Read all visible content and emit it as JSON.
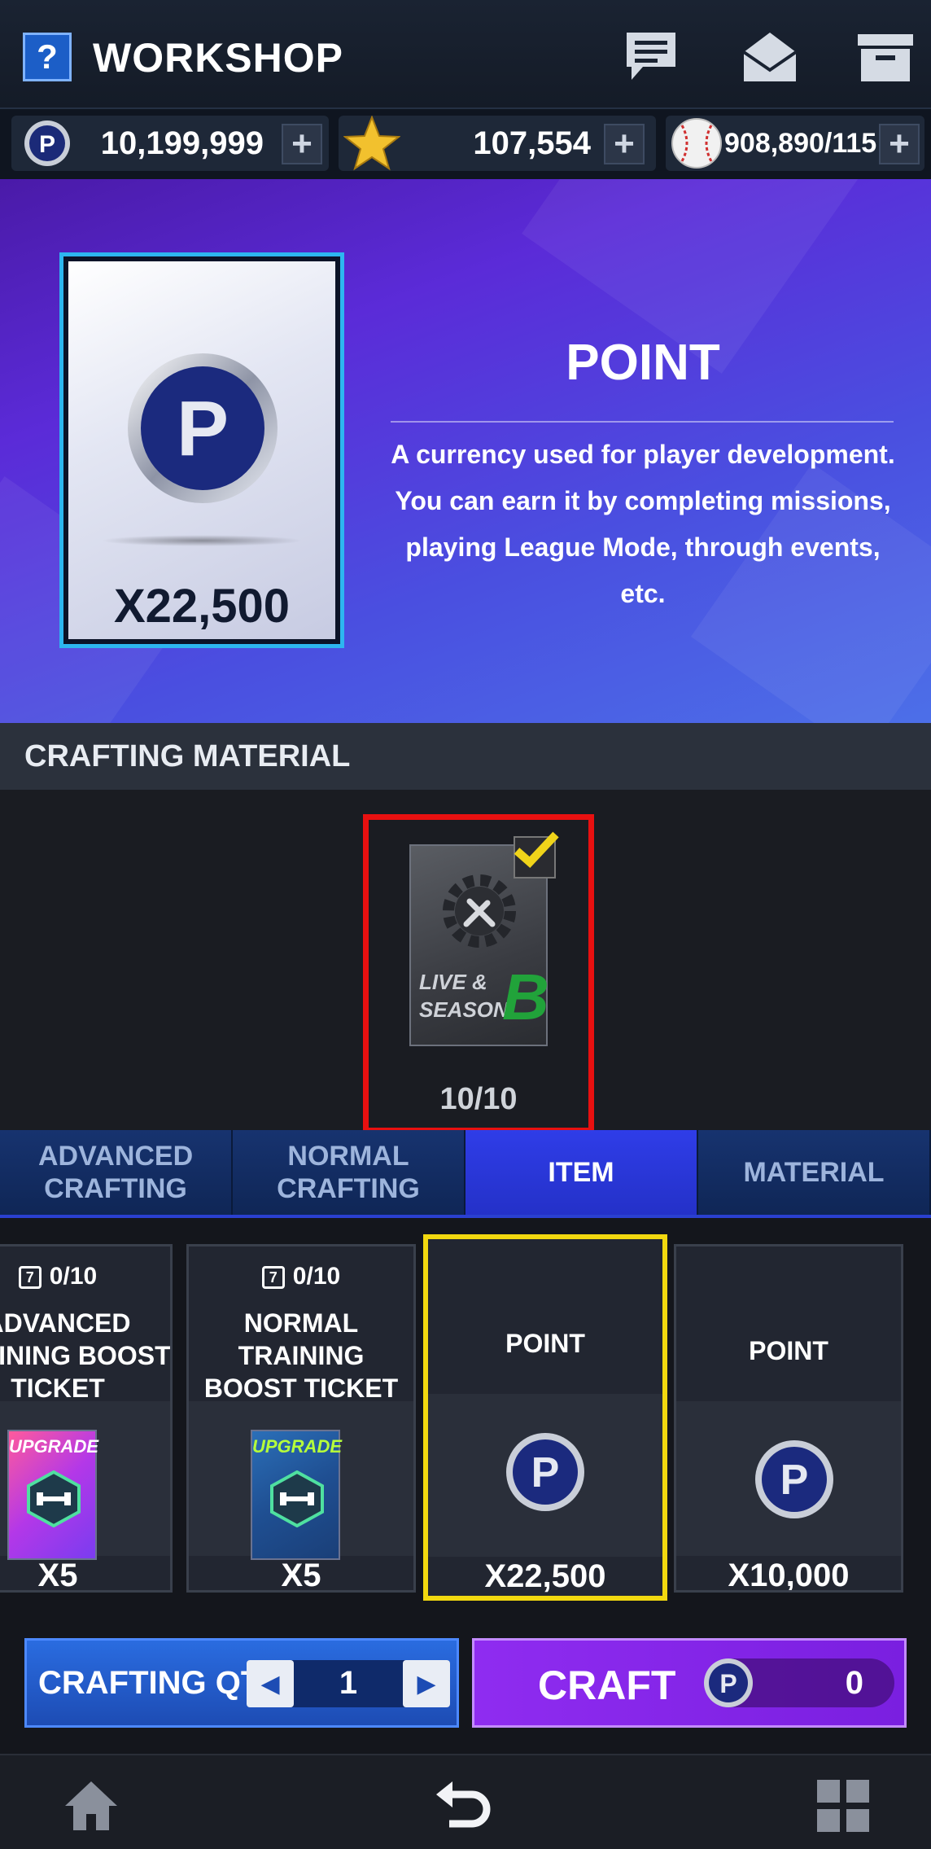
{
  "header": {
    "help_icon": "question-mark-icon",
    "title": "WORKSHOP",
    "icons": [
      "chat-icon",
      "mail-icon",
      "storage-box-icon"
    ]
  },
  "currencies": [
    {
      "icon": "point-coin-icon",
      "value": "10,199,999"
    },
    {
      "icon": "star-icon",
      "value": "107,554"
    },
    {
      "icon": "baseball-icon",
      "value": "908,890/115"
    }
  ],
  "hero": {
    "qty": "X22,500",
    "name": "POINT",
    "description": "A currency used for player development. You can earn it by completing missions, playing League Mode, through events, etc."
  },
  "crafting_material": {
    "heading": "CRAFTING MATERIAL",
    "card": {
      "line1": "LIVE &",
      "line2": "SEASON",
      "grade": "B",
      "count": "10/10",
      "checked": true
    }
  },
  "tabs": [
    {
      "label": "ADVANCED CRAFTING",
      "active": false
    },
    {
      "label": "NORMAL CRAFTING",
      "active": false
    },
    {
      "label": "ITEM",
      "active": true
    },
    {
      "label": "MATERIAL",
      "active": false
    }
  ],
  "items": [
    {
      "limit": "0/10",
      "name": "ADVANCED TRAINING BOOST TICKET",
      "badge": "UPGRADE",
      "qty": "X5"
    },
    {
      "limit": "0/10",
      "name": "NORMAL TRAINING BOOST TICKET",
      "badge": "UPGRADE",
      "qty": "X5"
    },
    {
      "name": "POINT",
      "qty": "X22,500",
      "selected": true
    },
    {
      "name": "POINT",
      "qty": "X10,000"
    }
  ],
  "action": {
    "qty_label": "CRAFTING QTY",
    "qty_value": "1",
    "craft_label": "CRAFT",
    "craft_cost": "0"
  },
  "nav": [
    "home-icon",
    "back-icon",
    "menu-grid-icon"
  ],
  "colors": {
    "accent_purple": "#8f2cf0",
    "accent_blue": "#2f3de8",
    "selected_border": "#f2d80f",
    "material_border": "#e81010"
  }
}
